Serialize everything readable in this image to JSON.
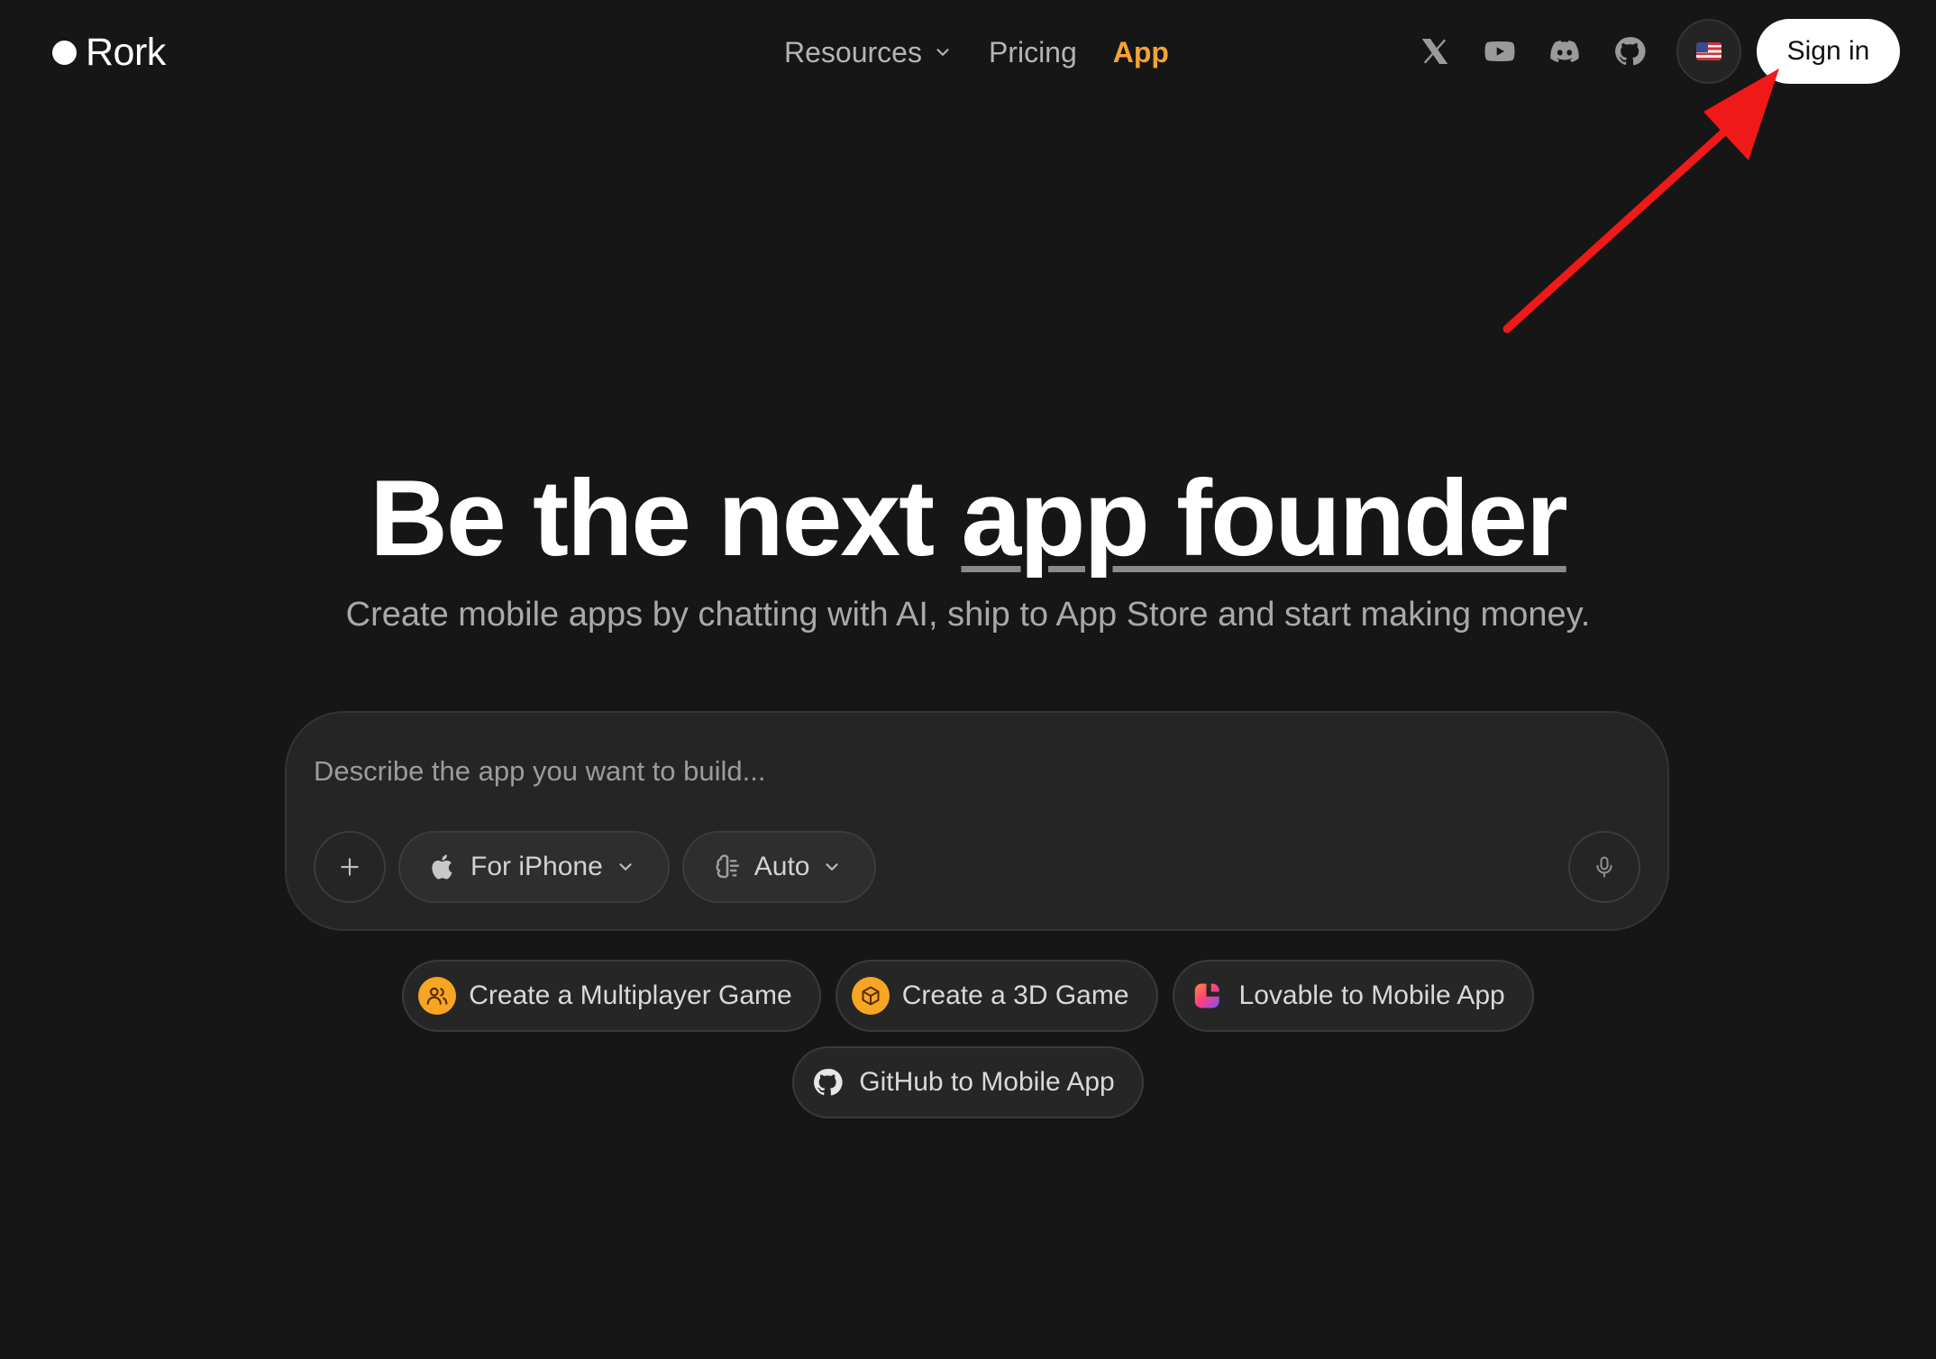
{
  "brand": {
    "name": "Rork"
  },
  "nav": {
    "resources": "Resources",
    "pricing": "Pricing",
    "app": "App"
  },
  "social": [
    "x-icon",
    "youtube-icon",
    "discord-icon",
    "github-icon"
  ],
  "header": {
    "signin_label": "Sign in",
    "locale": "us-flag-icon"
  },
  "hero": {
    "title_part1": "Be the next ",
    "title_part2": "app founder",
    "subtitle": "Create mobile apps by chatting with AI, ship to App Store and start making money."
  },
  "prompt": {
    "placeholder": "Describe the app you want to build...",
    "platform_label": "For iPhone",
    "model_label": "Auto"
  },
  "suggestions": [
    "Create a Multiplayer Game",
    "Create a 3D Game",
    "Lovable to Mobile App",
    "GitHub to Mobile App"
  ],
  "colors": {
    "background": "#161616",
    "accent": "#f4a336",
    "annotation_arrow": "#f01919"
  }
}
